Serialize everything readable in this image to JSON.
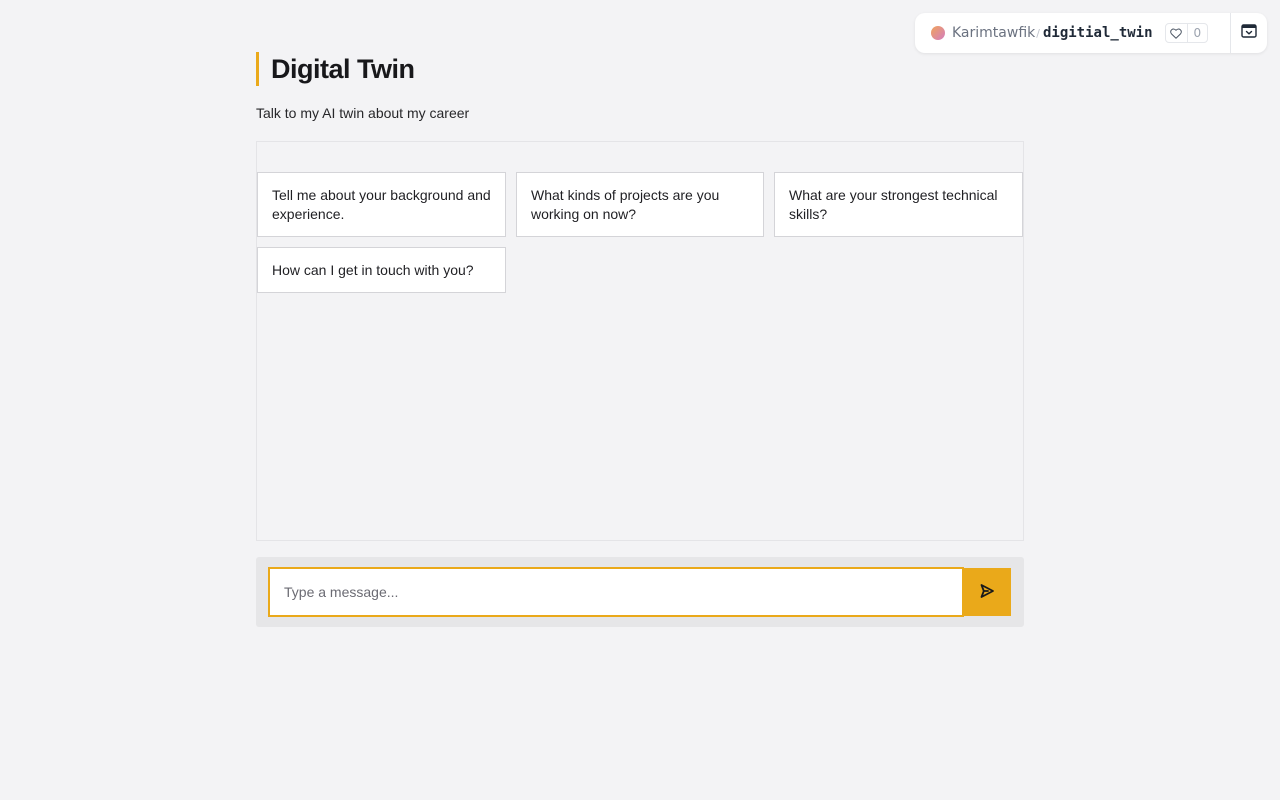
{
  "space_badge": {
    "owner": "Karimtawfik",
    "separator": "/",
    "space_name": "digitial_twin",
    "likes": "0",
    "icons": {
      "like": "heart-icon",
      "collapse": "collapse-icon"
    }
  },
  "header": {
    "title": "Digital Twin",
    "subtitle": "Talk to my AI twin about my career"
  },
  "examples": [
    "Tell me about your background and experience.",
    "What kinds of projects are you working on now?",
    "What are your strongest technical skills?",
    "How can I get in touch with you?"
  ],
  "composer": {
    "placeholder": "Type a message...",
    "value": "",
    "send_icon": "send-icon"
  },
  "colors": {
    "accent": "#eaa91a",
    "background": "#f3f3f5"
  }
}
